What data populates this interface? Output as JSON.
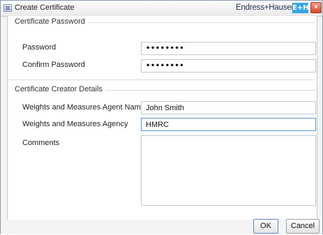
{
  "window": {
    "title": "Create Certificate",
    "brand_text": "Endress+Hauser",
    "brand_logo": "E+H",
    "close_glyph": "×"
  },
  "password_section": {
    "title": "Certificate Password",
    "password_label": "Password",
    "password_value": "••••••••",
    "confirm_label": "Confirm Password",
    "confirm_value": "••••••••"
  },
  "details_section": {
    "title": "Certificate Creator Details",
    "agent_label": "Weights and Measures Agent Name",
    "agent_value": "John Smith",
    "agency_label": "Weights and Measures Agency",
    "agency_value": "HMRC",
    "comments_label": "Comments",
    "comments_value": ""
  },
  "buttons": {
    "ok": "OK",
    "cancel": "Cancel"
  },
  "icons": {
    "app": "certificate-window-icon",
    "close": "close-icon"
  },
  "colors": {
    "brand_blue": "#39a6e1",
    "close_red": "#d9462a",
    "focus_border": "#5a93d6"
  }
}
